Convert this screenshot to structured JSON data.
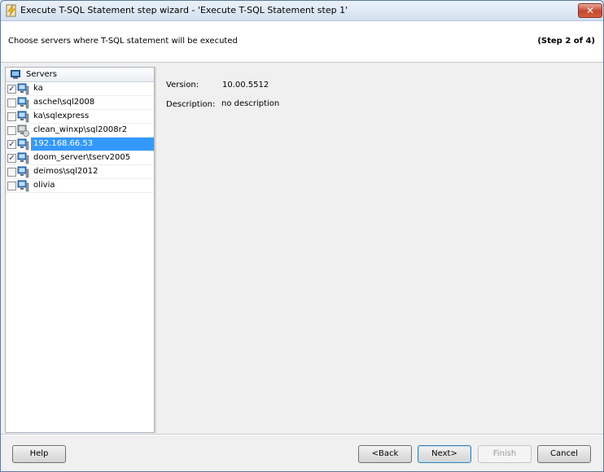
{
  "window": {
    "title": "Execute T-SQL Statement step wizard - 'Execute T-SQL Statement step 1'",
    "close_glyph": "✕"
  },
  "header": {
    "instruction": "Choose servers where T-SQL statement will be executed",
    "step": "(Step 2 of 4)"
  },
  "tree": {
    "header_label": "Servers",
    "header_icon": "servers-icon",
    "items": [
      {
        "label": "ka",
        "checked": true,
        "icon": "server-icon"
      },
      {
        "label": "aschel\\sql2008",
        "checked": false,
        "icon": "server-icon"
      },
      {
        "label": "ka\\sqlexpress",
        "checked": false,
        "icon": "server-icon"
      },
      {
        "label": "clean_winxp\\sql2008r2",
        "checked": false,
        "icon": "server-offline-icon"
      },
      {
        "label": "192.168.66.53",
        "checked": true,
        "icon": "server-icon",
        "selected": true
      },
      {
        "label": "doom_server\\tserv2005",
        "checked": true,
        "icon": "server-icon"
      },
      {
        "label": "deimos\\sql2012",
        "checked": false,
        "icon": "server-icon"
      },
      {
        "label": "olivia",
        "checked": false,
        "icon": "server-icon"
      }
    ]
  },
  "details": {
    "version_label": "Version:",
    "version_value": "10.00.5512",
    "description_label": "Description:",
    "description_value": "no description"
  },
  "buttons": {
    "help": "Help",
    "back": "<Back",
    "next": "Next>",
    "finish": "Finish",
    "cancel": "Cancel"
  },
  "colors": {
    "selection": "#3399ff",
    "close_button": "#c7452b"
  }
}
